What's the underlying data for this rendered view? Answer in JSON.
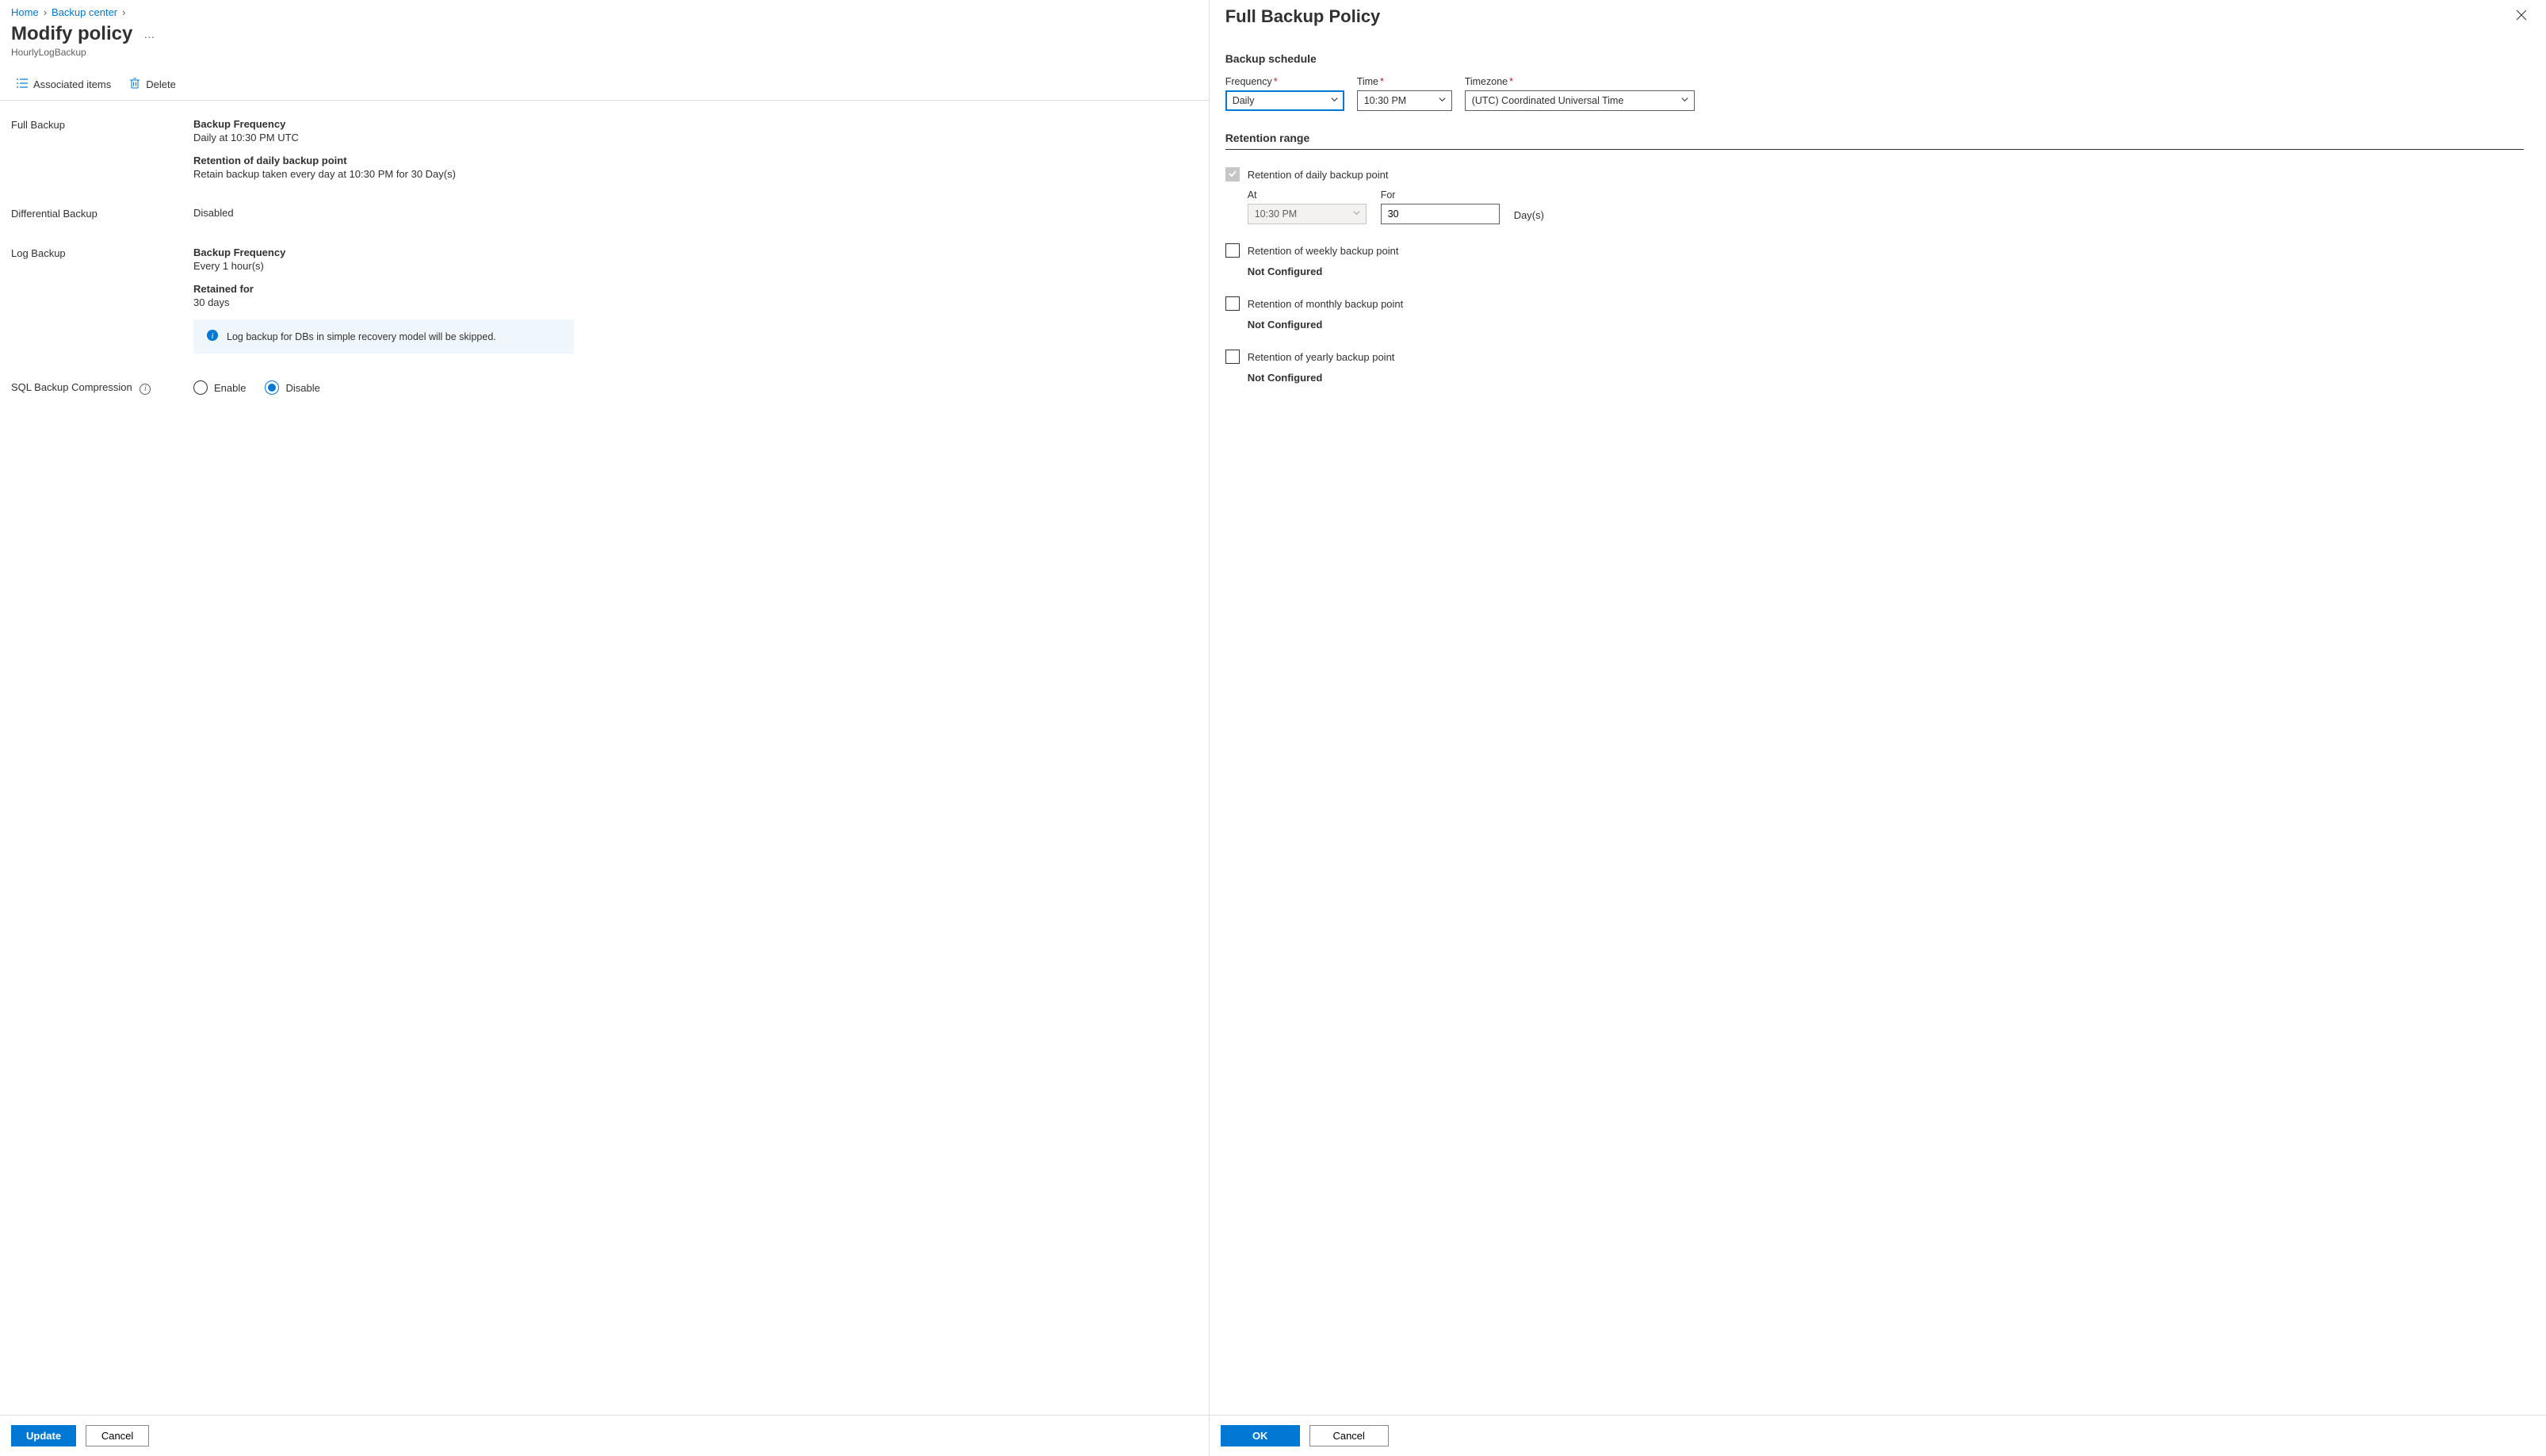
{
  "breadcrumbs": {
    "home": "Home",
    "backup_center": "Backup center"
  },
  "header": {
    "title": "Modify policy",
    "subtitle": "HourlyLogBackup"
  },
  "toolbar": {
    "associated_items": "Associated items",
    "delete": "Delete"
  },
  "sections": {
    "full_backup": {
      "label": "Full Backup",
      "freq_label": "Backup Frequency",
      "freq_value": "Daily at 10:30 PM UTC",
      "retention_label": "Retention of daily backup point",
      "retention_value": "Retain backup taken every day at 10:30 PM for 30 Day(s)"
    },
    "differential": {
      "label": "Differential Backup",
      "value": "Disabled"
    },
    "log_backup": {
      "label": "Log Backup",
      "freq_label": "Backup Frequency",
      "freq_value": "Every 1 hour(s)",
      "retain_label": "Retained for",
      "retain_value": "30 days",
      "info_text": "Log backup for DBs in simple recovery model will be skipped."
    },
    "compression": {
      "label": "SQL Backup Compression",
      "enable": "Enable",
      "disable": "Disable"
    }
  },
  "footer": {
    "update": "Update",
    "cancel": "Cancel"
  },
  "blade": {
    "title": "Full Backup Policy",
    "schedule_title": "Backup schedule",
    "frequency_label": "Frequency",
    "frequency_value": "Daily",
    "time_label": "Time",
    "time_value": "10:30 PM",
    "timezone_label": "Timezone",
    "timezone_value": "(UTC) Coordinated Universal Time",
    "retention_title": "Retention range",
    "daily": {
      "label": "Retention of daily backup point",
      "at_label": "At",
      "at_value": "10:30 PM",
      "for_label": "For",
      "for_value": "30",
      "unit": "Day(s)"
    },
    "weekly": {
      "label": "Retention of weekly backup point",
      "status": "Not Configured"
    },
    "monthly": {
      "label": "Retention of monthly backup point",
      "status": "Not Configured"
    },
    "yearly": {
      "label": "Retention of yearly backup point",
      "status": "Not Configured"
    },
    "ok": "OK",
    "cancel": "Cancel"
  }
}
